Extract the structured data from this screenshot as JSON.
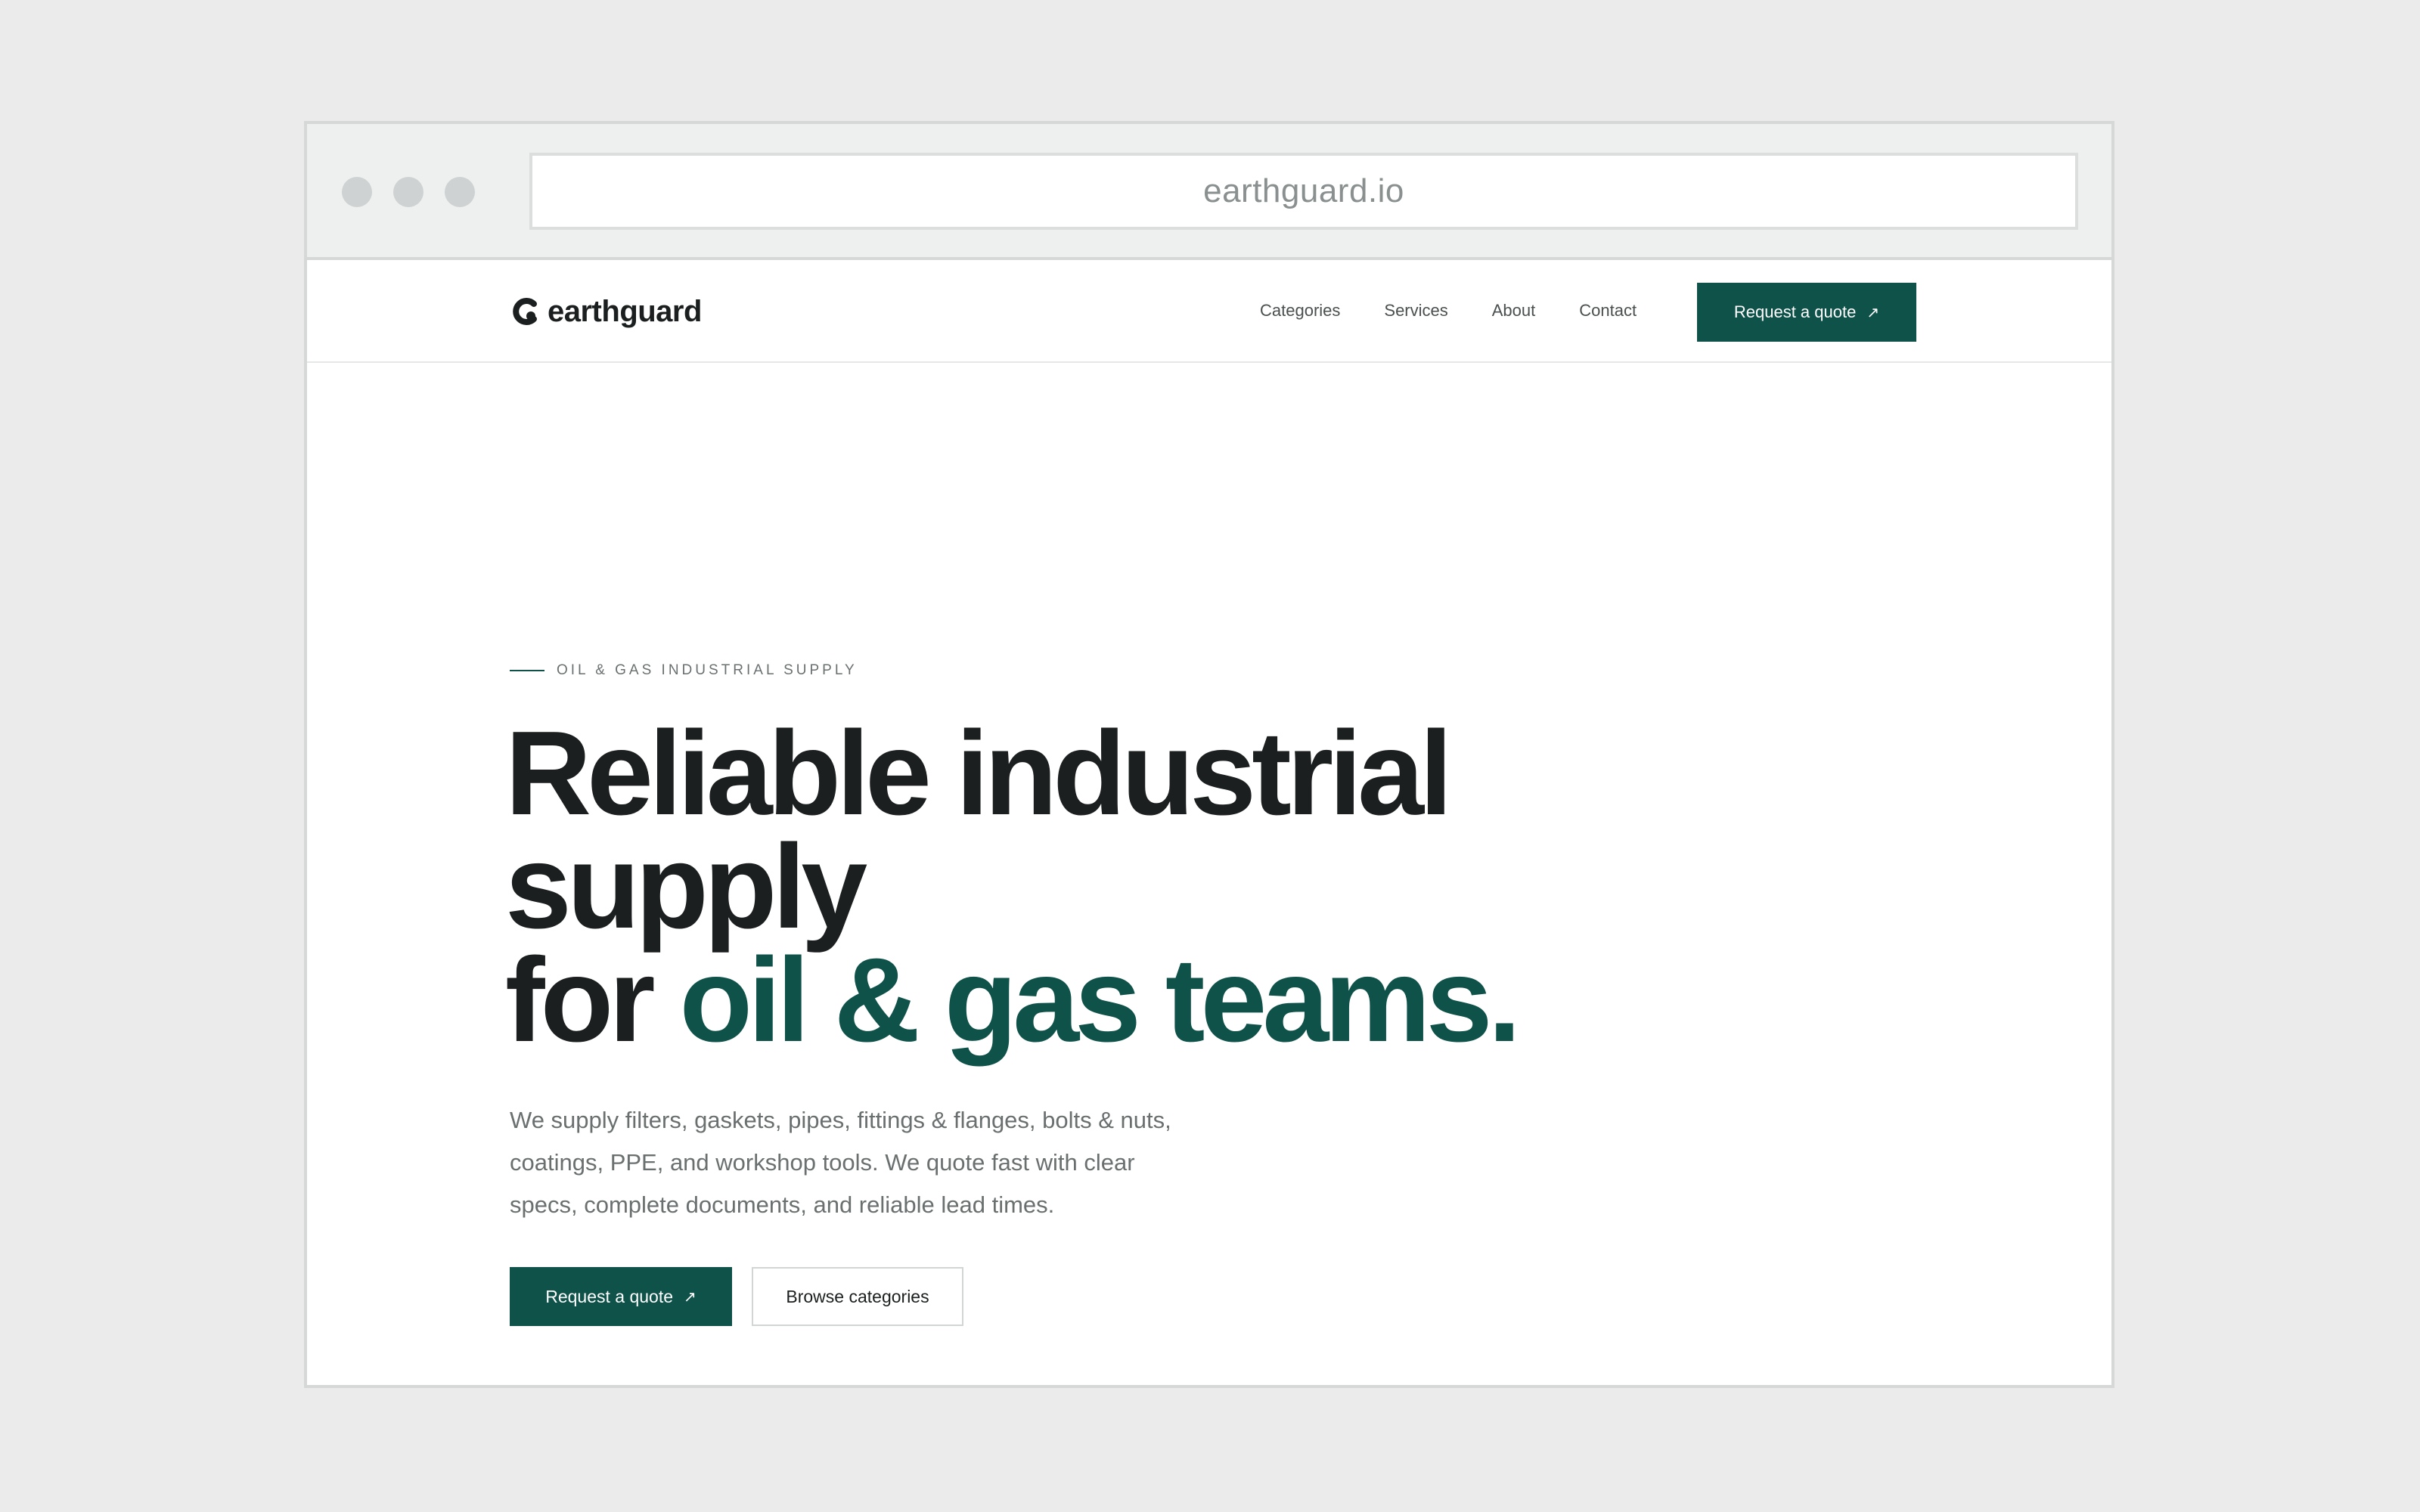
{
  "browser": {
    "url": "earthguard.io"
  },
  "header": {
    "logo_text": "earthguard",
    "nav": [
      {
        "label": "Categories"
      },
      {
        "label": "Services"
      },
      {
        "label": "About"
      },
      {
        "label": "Contact"
      }
    ],
    "cta_label": "Request a quote",
    "cta_icon": "arrow-up-right-icon"
  },
  "hero": {
    "eyebrow": "OIL & GAS INDUSTRIAL SUPPLY",
    "headline_line1": "Reliable industrial",
    "headline_line2": "supply",
    "headline_line3_prefix": "for ",
    "headline_line3_accent": "oil & gas teams.",
    "lead": "We supply filters, gaskets, pipes, fittings & flanges, bolts & nuts, coatings, PPE, and workshop tools. We quote fast with clear specs, complete documents, and reliable lead times.",
    "primary_cta": "Request a quote",
    "secondary_cta": "Browse categories"
  },
  "colors": {
    "brand": "#0e5249",
    "text": "#1c1f1f",
    "muted": "#6a6f6f",
    "background": "#ebebeb"
  }
}
